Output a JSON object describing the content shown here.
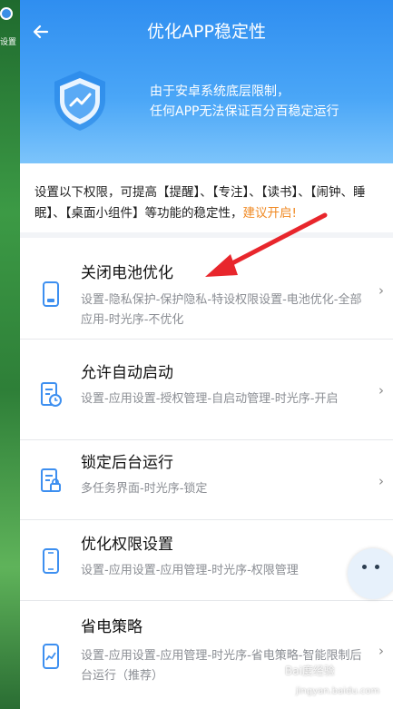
{
  "desktop": {
    "label": "设置"
  },
  "header": {
    "title": "优化APP稳定性",
    "banner_line1": "由于安卓系统底层限制，",
    "banner_line2": "任何APP无法保证百分百稳定运行"
  },
  "intro": {
    "text": "设置以下权限，可提高【提醒】、【专注】、【读书】、【闹钟、睡眠】、【桌面小组件】等功能的稳定性，",
    "highlight": "建议开启!"
  },
  "items": [
    {
      "name": "关闭电池优化",
      "path": "设置-隐私保护-保护隐私-特设权限设置-电池优化-全部应用-时光序-不优化",
      "icon": "battery-icon"
    },
    {
      "name": "允许自动启动",
      "path": "设置-应用设置-授权管理-自启动管理-时光序-开启",
      "icon": "auto-start-icon"
    },
    {
      "name": "锁定后台运行",
      "path": "多任务界面-时光序-锁定",
      "icon": "lock-doc-icon"
    },
    {
      "name": "优化权限设置",
      "path": "设置-应用设置-应用管理-时光序-权限管理",
      "icon": "phone-icon"
    },
    {
      "name": "省电策略",
      "path": "设置-应用设置-应用管理-时光序-省电策略-智能限制后台运行（推荐）",
      "icon": "chart-phone-icon"
    }
  ],
  "chevron": "›",
  "watermark": "Bai度经验",
  "watermark_sub": "jingyan.baidu.com",
  "colors": {
    "header_blue": "#2f8ef0",
    "highlight_orange": "#f08a24",
    "arrow_red": "#e8262c",
    "icon_blue": "#3d8ff0"
  }
}
